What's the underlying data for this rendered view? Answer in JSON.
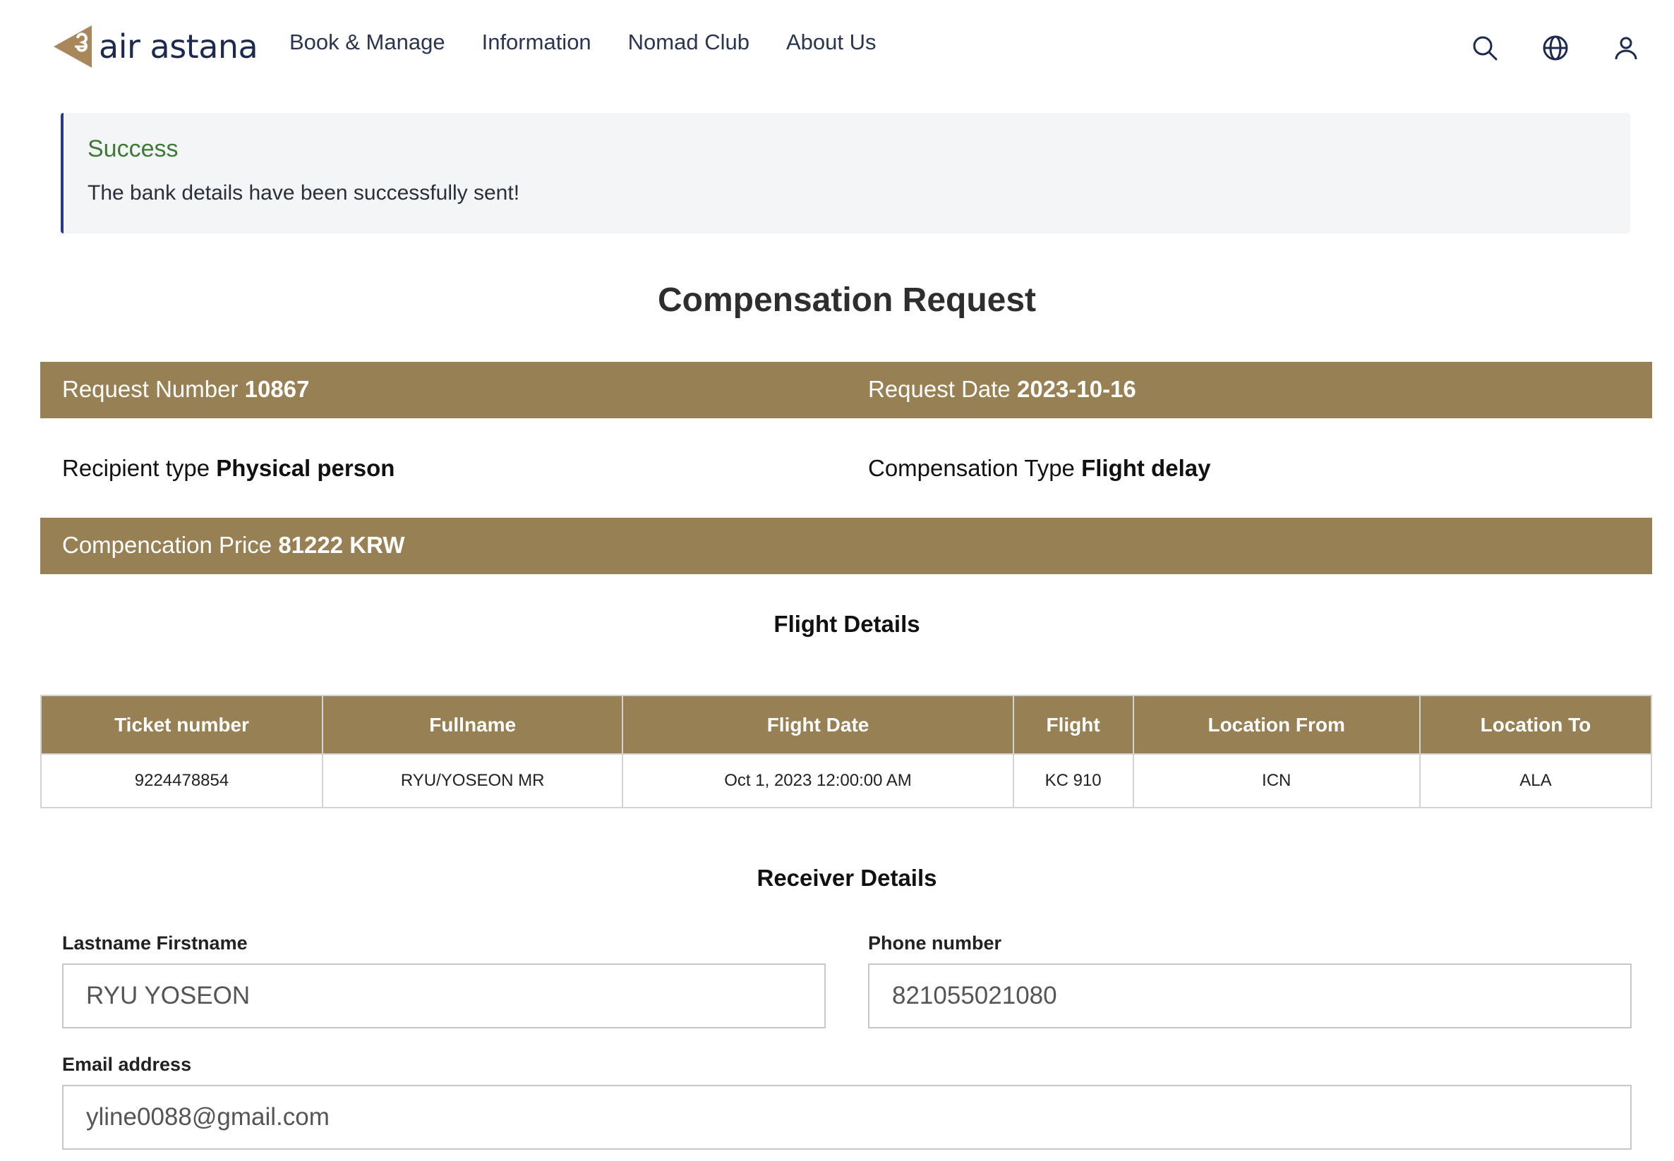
{
  "brand": {
    "logo_text": "air astana",
    "accent": "#978053",
    "navy": "#1d2a4f"
  },
  "nav": [
    "Book & Manage",
    "Information",
    "Nomad Club",
    "About Us"
  ],
  "header_icons": [
    "search-icon",
    "globe-icon",
    "user-icon"
  ],
  "alert": {
    "title": "Success",
    "message": "The bank details have been successfully sent!"
  },
  "page_title": "Compensation Request",
  "request": {
    "number_label": "Request Number",
    "number": "10867",
    "date_label": "Request Date",
    "date": "2023-10-16",
    "recipient_label": "Recipient type",
    "recipient": "Physical person",
    "comp_type_label": "Compensation Type",
    "comp_type": "Flight delay",
    "price_label": "Compencation Price",
    "price": "81222 KRW"
  },
  "flight_details": {
    "title": "Flight Details",
    "headers": [
      "Ticket number",
      "Fullname",
      "Flight Date",
      "Flight",
      "Location From",
      "Location To"
    ],
    "row": [
      "9224478854",
      "RYU/YOSEON MR",
      "Oct 1, 2023 12:00:00 AM",
      "KC 910",
      "ICN",
      "ALA"
    ]
  },
  "receiver": {
    "title": "Receiver Details",
    "name_label": "Lastname Firstname",
    "name": "RYU YOSEON",
    "phone_label": "Phone number",
    "phone": "821055021080",
    "email_label": "Email address",
    "email": "yline0088@gmail.com"
  }
}
